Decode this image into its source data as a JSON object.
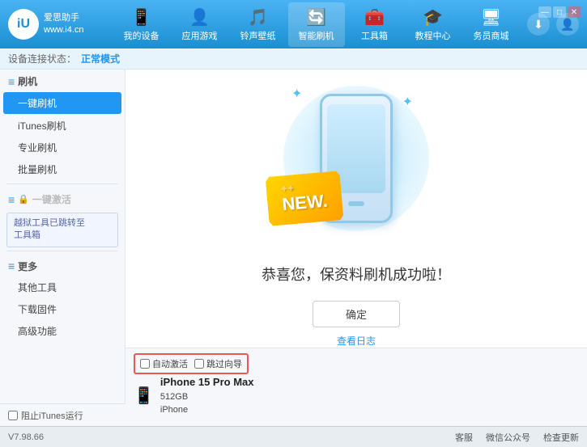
{
  "header": {
    "logo": {
      "circle": "iU",
      "line1": "爱思助手",
      "line2": "www.i4.cn"
    },
    "nav": [
      {
        "id": "my-device",
        "icon": "📱",
        "label": "我的设备"
      },
      {
        "id": "apps-games",
        "icon": "👤",
        "label": "应用游戏"
      },
      {
        "id": "ringtones",
        "icon": "🎵",
        "label": "铃声壁纸"
      },
      {
        "id": "smart-flash",
        "icon": "🔄",
        "label": "智能刷机"
      },
      {
        "id": "toolbox",
        "icon": "🧰",
        "label": "工具箱"
      },
      {
        "id": "tutorials",
        "icon": "🎓",
        "label": "教程中心"
      },
      {
        "id": "service",
        "icon": "🖥",
        "label": "务员商城"
      }
    ],
    "right_buttons": [
      "⬇",
      "👤"
    ]
  },
  "window_controls": [
    "—",
    "□",
    "✕"
  ],
  "status_bar": {
    "label": "设备连接状态：",
    "value": "正常模式"
  },
  "sidebar": {
    "sections": [
      {
        "id": "flash-section",
        "icon": "📱",
        "header": "刷机",
        "items": [
          {
            "id": "one-key-flash",
            "label": "一键刷机",
            "active": true
          },
          {
            "id": "itunes-flash",
            "label": "iTunes刷机",
            "active": false
          },
          {
            "id": "pro-flash",
            "label": "专业刷机",
            "active": false
          },
          {
            "id": "batch-flash",
            "label": "批量刷机",
            "active": false
          }
        ]
      },
      {
        "id": "one-key-activate",
        "header": "一键激活",
        "disabled": true,
        "note_line1": "越狱工具已跳转至",
        "note_line2": "工具箱"
      },
      {
        "id": "more-section",
        "header": "更多",
        "items": [
          {
            "id": "other-tools",
            "label": "其他工具"
          },
          {
            "id": "download-firmware",
            "label": "下载固件"
          },
          {
            "id": "advanced",
            "label": "高级功能"
          }
        ]
      }
    ]
  },
  "content": {
    "success_message": "恭喜您，保资料刷机成功啦！",
    "confirm_button": "确定",
    "log_link": "查看日志",
    "new_badge": "NEW.",
    "new_badge_stars": "✦✦"
  },
  "device_bar": {
    "auto_activate": "自动激活",
    "quick_guide": "跳过向导",
    "device_name": "iPhone 15 Pro Max",
    "storage": "512GB",
    "type": "iPhone"
  },
  "block_itunes": {
    "label": "阻止iTunes运行"
  },
  "footer": {
    "version": "V7.98.66",
    "links": [
      "客服",
      "微信公众号",
      "检查更新"
    ]
  }
}
